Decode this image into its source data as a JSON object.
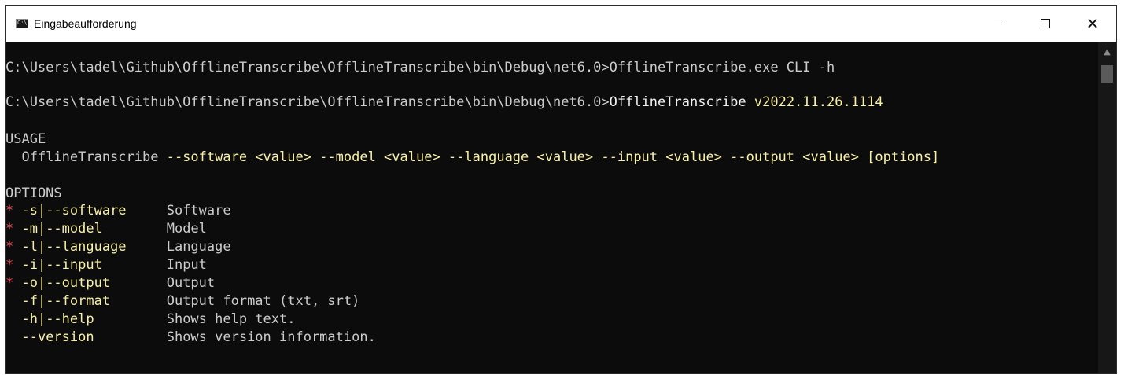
{
  "window": {
    "title": "Eingabeaufforderung",
    "icon": "cmd-icon",
    "icon_glyph": "C:\\",
    "controls": {
      "minimize": "minimize-icon",
      "maximize": "maximize-icon",
      "close": "close-icon",
      "close_glyph": "✕"
    }
  },
  "console": {
    "line1": {
      "prompt": "C:\\Users\\tadel\\Github\\OfflineTranscribe\\OfflineTranscribe\\bin\\Debug\\net6.0>",
      "command": "OfflineTranscribe.exe CLI -h"
    },
    "line2": {
      "prompt": "C:\\Users\\tadel\\Github\\OfflineTranscribe\\OfflineTranscribe\\bin\\Debug\\net6.0>",
      "name": "OfflineTranscribe",
      "version": "v2022.11.26.1114"
    },
    "usage_header": "USAGE",
    "usage": {
      "exe": "  OfflineTranscribe",
      "args": " --software <value> --model <value> --language <value> --input <value> --output <value> [options]"
    },
    "options_header": "OPTIONS",
    "options": [
      {
        "marker": "*",
        "flag": " -s|--software     ",
        "desc": "Software"
      },
      {
        "marker": "*",
        "flag": " -m|--model        ",
        "desc": "Model"
      },
      {
        "marker": "*",
        "flag": " -l|--language     ",
        "desc": "Language"
      },
      {
        "marker": "*",
        "flag": " -i|--input        ",
        "desc": "Input"
      },
      {
        "marker": "*",
        "flag": " -o|--output       ",
        "desc": "Output"
      },
      {
        "marker": " ",
        "flag": " -f|--format       ",
        "desc": "Output format (txt, srt)"
      },
      {
        "marker": " ",
        "flag": " -h|--help         ",
        "desc": "Shows help text."
      },
      {
        "marker": " ",
        "flag": " --version         ",
        "desc": "Shows version information."
      }
    ]
  },
  "colors": {
    "background": "#0c0c0c",
    "text": "#cccccc",
    "highlight": "#f9f1a5",
    "required": "#e74856"
  }
}
